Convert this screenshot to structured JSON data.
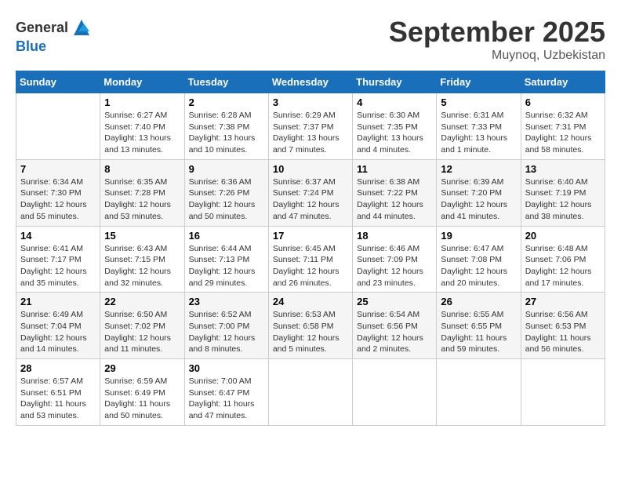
{
  "header": {
    "logo_general": "General",
    "logo_blue": "Blue",
    "month": "September 2025",
    "location": "Muynoq, Uzbekistan"
  },
  "days_of_week": [
    "Sunday",
    "Monday",
    "Tuesday",
    "Wednesday",
    "Thursday",
    "Friday",
    "Saturday"
  ],
  "weeks": [
    [
      {
        "day": "",
        "sunrise": "",
        "sunset": "",
        "daylight": ""
      },
      {
        "day": "1",
        "sunrise": "Sunrise: 6:27 AM",
        "sunset": "Sunset: 7:40 PM",
        "daylight": "Daylight: 13 hours and 13 minutes."
      },
      {
        "day": "2",
        "sunrise": "Sunrise: 6:28 AM",
        "sunset": "Sunset: 7:38 PM",
        "daylight": "Daylight: 13 hours and 10 minutes."
      },
      {
        "day": "3",
        "sunrise": "Sunrise: 6:29 AM",
        "sunset": "Sunset: 7:37 PM",
        "daylight": "Daylight: 13 hours and 7 minutes."
      },
      {
        "day": "4",
        "sunrise": "Sunrise: 6:30 AM",
        "sunset": "Sunset: 7:35 PM",
        "daylight": "Daylight: 13 hours and 4 minutes."
      },
      {
        "day": "5",
        "sunrise": "Sunrise: 6:31 AM",
        "sunset": "Sunset: 7:33 PM",
        "daylight": "Daylight: 13 hours and 1 minute."
      },
      {
        "day": "6",
        "sunrise": "Sunrise: 6:32 AM",
        "sunset": "Sunset: 7:31 PM",
        "daylight": "Daylight: 12 hours and 58 minutes."
      }
    ],
    [
      {
        "day": "7",
        "sunrise": "Sunrise: 6:34 AM",
        "sunset": "Sunset: 7:30 PM",
        "daylight": "Daylight: 12 hours and 55 minutes."
      },
      {
        "day": "8",
        "sunrise": "Sunrise: 6:35 AM",
        "sunset": "Sunset: 7:28 PM",
        "daylight": "Daylight: 12 hours and 53 minutes."
      },
      {
        "day": "9",
        "sunrise": "Sunrise: 6:36 AM",
        "sunset": "Sunset: 7:26 PM",
        "daylight": "Daylight: 12 hours and 50 minutes."
      },
      {
        "day": "10",
        "sunrise": "Sunrise: 6:37 AM",
        "sunset": "Sunset: 7:24 PM",
        "daylight": "Daylight: 12 hours and 47 minutes."
      },
      {
        "day": "11",
        "sunrise": "Sunrise: 6:38 AM",
        "sunset": "Sunset: 7:22 PM",
        "daylight": "Daylight: 12 hours and 44 minutes."
      },
      {
        "day": "12",
        "sunrise": "Sunrise: 6:39 AM",
        "sunset": "Sunset: 7:20 PM",
        "daylight": "Daylight: 12 hours and 41 minutes."
      },
      {
        "day": "13",
        "sunrise": "Sunrise: 6:40 AM",
        "sunset": "Sunset: 7:19 PM",
        "daylight": "Daylight: 12 hours and 38 minutes."
      }
    ],
    [
      {
        "day": "14",
        "sunrise": "Sunrise: 6:41 AM",
        "sunset": "Sunset: 7:17 PM",
        "daylight": "Daylight: 12 hours and 35 minutes."
      },
      {
        "day": "15",
        "sunrise": "Sunrise: 6:43 AM",
        "sunset": "Sunset: 7:15 PM",
        "daylight": "Daylight: 12 hours and 32 minutes."
      },
      {
        "day": "16",
        "sunrise": "Sunrise: 6:44 AM",
        "sunset": "Sunset: 7:13 PM",
        "daylight": "Daylight: 12 hours and 29 minutes."
      },
      {
        "day": "17",
        "sunrise": "Sunrise: 6:45 AM",
        "sunset": "Sunset: 7:11 PM",
        "daylight": "Daylight: 12 hours and 26 minutes."
      },
      {
        "day": "18",
        "sunrise": "Sunrise: 6:46 AM",
        "sunset": "Sunset: 7:09 PM",
        "daylight": "Daylight: 12 hours and 23 minutes."
      },
      {
        "day": "19",
        "sunrise": "Sunrise: 6:47 AM",
        "sunset": "Sunset: 7:08 PM",
        "daylight": "Daylight: 12 hours and 20 minutes."
      },
      {
        "day": "20",
        "sunrise": "Sunrise: 6:48 AM",
        "sunset": "Sunset: 7:06 PM",
        "daylight": "Daylight: 12 hours and 17 minutes."
      }
    ],
    [
      {
        "day": "21",
        "sunrise": "Sunrise: 6:49 AM",
        "sunset": "Sunset: 7:04 PM",
        "daylight": "Daylight: 12 hours and 14 minutes."
      },
      {
        "day": "22",
        "sunrise": "Sunrise: 6:50 AM",
        "sunset": "Sunset: 7:02 PM",
        "daylight": "Daylight: 12 hours and 11 minutes."
      },
      {
        "day": "23",
        "sunrise": "Sunrise: 6:52 AM",
        "sunset": "Sunset: 7:00 PM",
        "daylight": "Daylight: 12 hours and 8 minutes."
      },
      {
        "day": "24",
        "sunrise": "Sunrise: 6:53 AM",
        "sunset": "Sunset: 6:58 PM",
        "daylight": "Daylight: 12 hours and 5 minutes."
      },
      {
        "day": "25",
        "sunrise": "Sunrise: 6:54 AM",
        "sunset": "Sunset: 6:56 PM",
        "daylight": "Daylight: 12 hours and 2 minutes."
      },
      {
        "day": "26",
        "sunrise": "Sunrise: 6:55 AM",
        "sunset": "Sunset: 6:55 PM",
        "daylight": "Daylight: 11 hours and 59 minutes."
      },
      {
        "day": "27",
        "sunrise": "Sunrise: 6:56 AM",
        "sunset": "Sunset: 6:53 PM",
        "daylight": "Daylight: 11 hours and 56 minutes."
      }
    ],
    [
      {
        "day": "28",
        "sunrise": "Sunrise: 6:57 AM",
        "sunset": "Sunset: 6:51 PM",
        "daylight": "Daylight: 11 hours and 53 minutes."
      },
      {
        "day": "29",
        "sunrise": "Sunrise: 6:59 AM",
        "sunset": "Sunset: 6:49 PM",
        "daylight": "Daylight: 11 hours and 50 minutes."
      },
      {
        "day": "30",
        "sunrise": "Sunrise: 7:00 AM",
        "sunset": "Sunset: 6:47 PM",
        "daylight": "Daylight: 11 hours and 47 minutes."
      },
      {
        "day": "",
        "sunrise": "",
        "sunset": "",
        "daylight": ""
      },
      {
        "day": "",
        "sunrise": "",
        "sunset": "",
        "daylight": ""
      },
      {
        "day": "",
        "sunrise": "",
        "sunset": "",
        "daylight": ""
      },
      {
        "day": "",
        "sunrise": "",
        "sunset": "",
        "daylight": ""
      }
    ]
  ]
}
